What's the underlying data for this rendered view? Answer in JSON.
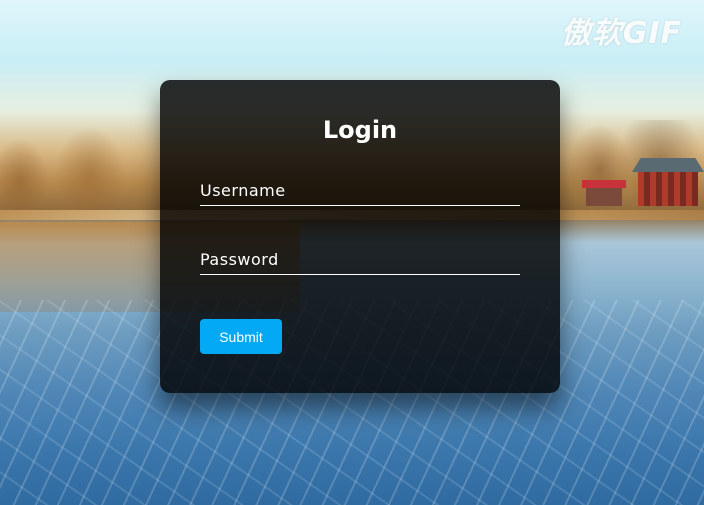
{
  "watermark": "傲软GIF",
  "login": {
    "title": "Login",
    "username_label": "Username",
    "password_label": "Password",
    "username_value": "",
    "password_value": "",
    "submit_label": "Submit"
  },
  "colors": {
    "panel_bg": "#000000",
    "button": "#03a9f4",
    "text": "#ffffff"
  }
}
